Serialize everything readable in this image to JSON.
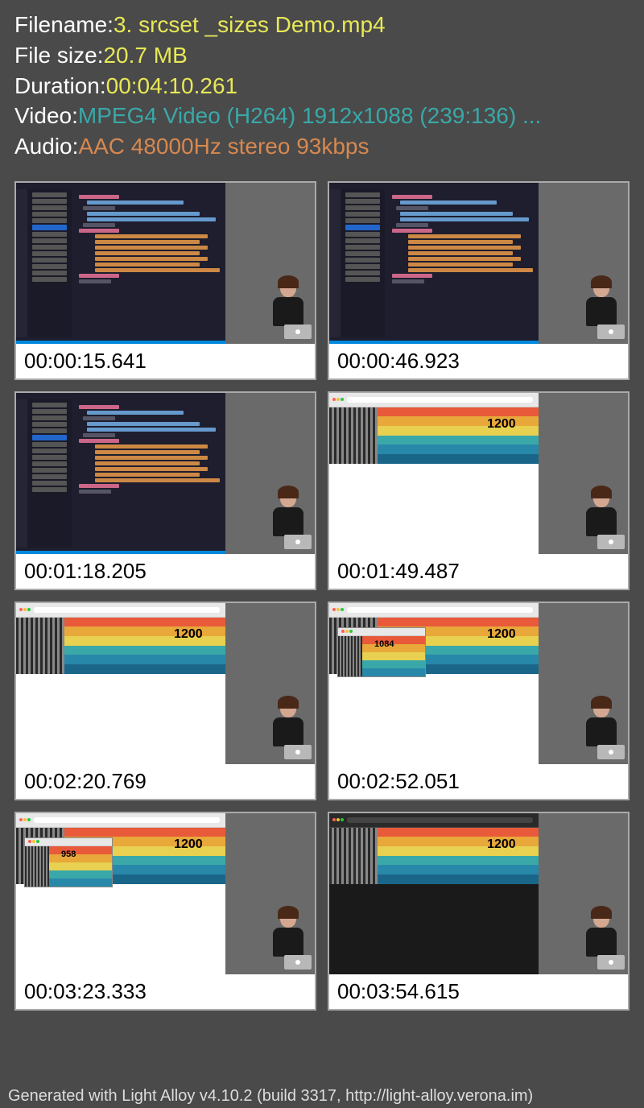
{
  "info": {
    "filename_label": "Filename: ",
    "filename_value": "3. srcset _sizes Demo.mp4",
    "filesize_label": "File size: ",
    "filesize_value": "20.7 MB",
    "duration_label": "Duration: ",
    "duration_value": "00:04:10.261",
    "video_label": "Video: ",
    "video_value": "MPEG4 Video (H264) 1912x1088 (239:136) ...",
    "audio_label": "Audio: ",
    "audio_value": "AAC 48000Hz stereo 93kbps"
  },
  "thumbnails": [
    {
      "time": "00:00:15.641",
      "type": "code"
    },
    {
      "time": "00:00:46.923",
      "type": "code"
    },
    {
      "time": "00:01:18.205",
      "type": "code"
    },
    {
      "time": "00:01:49.487",
      "type": "browser",
      "num": "1200"
    },
    {
      "time": "00:02:20.769",
      "type": "browser",
      "num": "1200"
    },
    {
      "time": "00:02:52.051",
      "type": "browser2",
      "num": "1200",
      "num2": "1084"
    },
    {
      "time": "00:03:23.333",
      "type": "browser2",
      "num": "1200",
      "num2": "958"
    },
    {
      "time": "00:03:54.615",
      "type": "dark",
      "num": "1200"
    }
  ],
  "footer": "Generated with Light Alloy v4.10.2 (build 3317, http://light-alloy.verona.im)"
}
